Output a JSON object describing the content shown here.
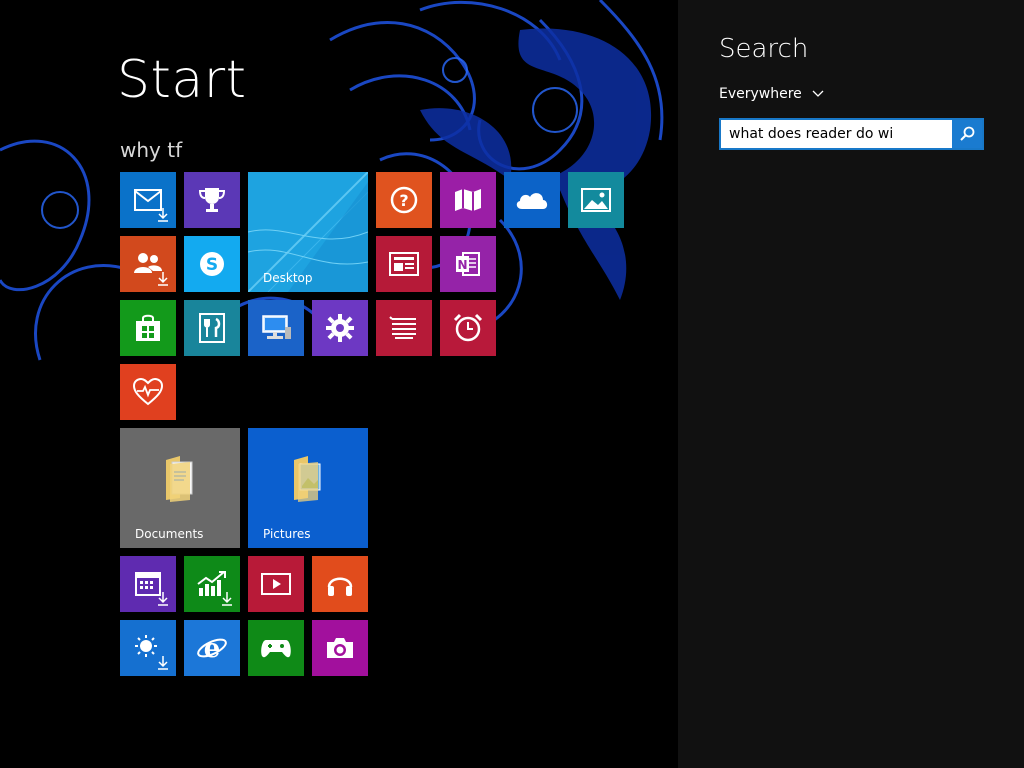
{
  "start": {
    "title": "Start",
    "user": "why tf"
  },
  "tiles": {
    "desktop": {
      "label": "Desktop",
      "color": "#1ea3e0"
    },
    "documents": {
      "label": "Documents",
      "color": "#696969"
    },
    "pictures": {
      "label": "Pictures",
      "color": "#0b5fcf"
    }
  },
  "colors": {
    "mail": "#0a72c9",
    "games": "#5b38b6",
    "people": "#d2491d",
    "skype": "#13aaf0",
    "store": "#139a1b",
    "food": "#19859b",
    "pc": "#1b63c8",
    "settings": "#6d38c3",
    "help": "#e0531f",
    "maps": "#9b1ea6",
    "onedrive": "#0c63c8",
    "photos": "#138a9d",
    "news": "#b61a38",
    "onenote": "#9523a8",
    "reading": "#b61a38",
    "alarms": "#b8193a",
    "health": "#e0401f",
    "calendar": "#5f2bb0",
    "finance": "#0e8a18",
    "video": "#b81a38",
    "music": "#e14c1c",
    "weather": "#1570d0",
    "ie": "#1c77d8",
    "xbox": "#0f8a17",
    "camera": "#a2109d",
    "panel_bg": "#111111",
    "search_accent": "#1a7bd0"
  },
  "search": {
    "title": "Search",
    "scope": "Everywhere",
    "query": "what does reader do wi"
  }
}
